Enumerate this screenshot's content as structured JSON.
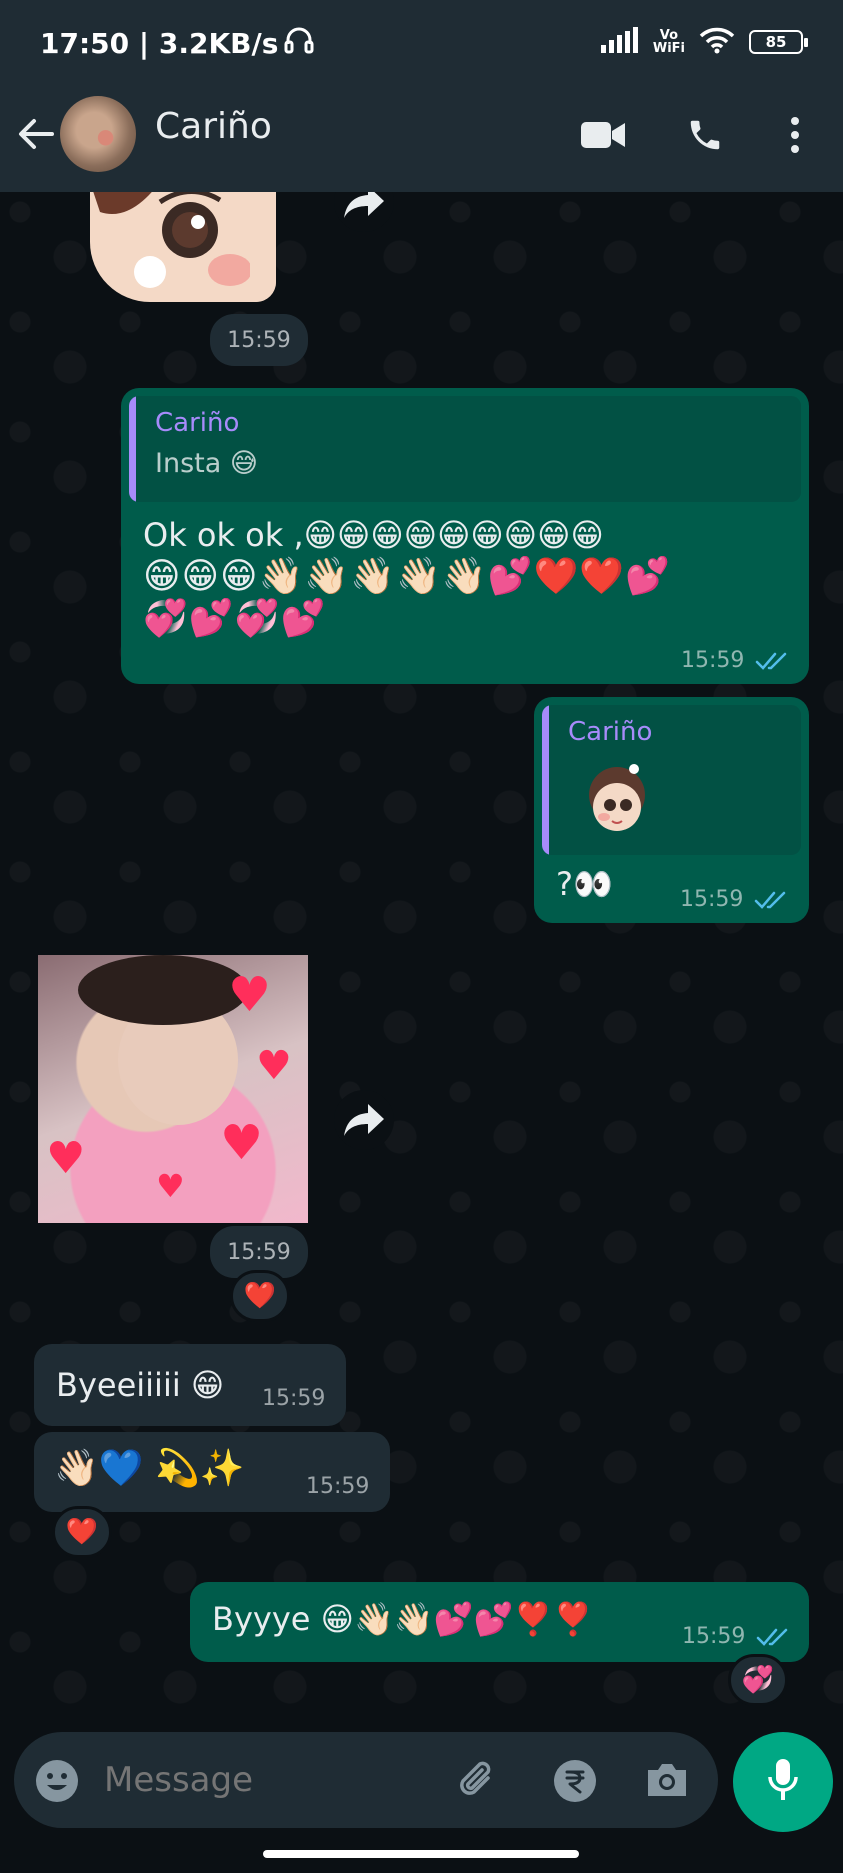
{
  "status_bar": {
    "time_speed": "17:50 | 3.2KB/s",
    "vowifi_top": "Vo",
    "vowifi_bottom": "WiFi",
    "battery": "85"
  },
  "header": {
    "contact_name": "Cariño"
  },
  "messages": {
    "sticker_time": "15:59",
    "msg1": {
      "quote_name": "Cariño",
      "quote_text": "Insta 😅",
      "line1": "Ok ok ok ,😁😁😁😁😁😁😁😁😁",
      "line2": "😁😁😁👋🏻👋🏻👋🏻👋🏻👋🏻💕❤️❤️💕",
      "line3": "💞💕💞💕",
      "time": "15:59"
    },
    "msg2": {
      "quote_name": "Cariño",
      "text": "?👀",
      "time": "15:59"
    },
    "photo": {
      "time": "15:59",
      "reaction": "❤️"
    },
    "msg3": {
      "text": "Byeeiiiii 😁",
      "time": "15:59"
    },
    "msg4": {
      "text": "👋🏻💙 💫✨",
      "time": "15:59",
      "reaction": "❤️"
    },
    "msg5": {
      "text": "Byyye 😁👋🏻👋🏻💕💕❣️❣️",
      "time": "15:59",
      "reaction": "💞"
    }
  },
  "input": {
    "placeholder": "Message"
  },
  "colors": {
    "header_bg": "#1f2c34",
    "chat_bg": "#0b1014",
    "outgoing_bubble": "#005c4b",
    "incoming_bubble": "#1f2c34",
    "accent_green": "#00a884",
    "quote_name": "#a78bfa",
    "read_tick": "#53bdeb"
  },
  "icons": [
    "back-arrow-icon",
    "video-call-icon",
    "phone-icon",
    "more-options-icon",
    "emoji-icon",
    "attach-icon",
    "rupee-payment-icon",
    "camera-icon",
    "mic-icon",
    "forward-icon",
    "double-tick-icon",
    "headphones-icon",
    "signal-icon",
    "wifi-icon",
    "battery-icon"
  ]
}
